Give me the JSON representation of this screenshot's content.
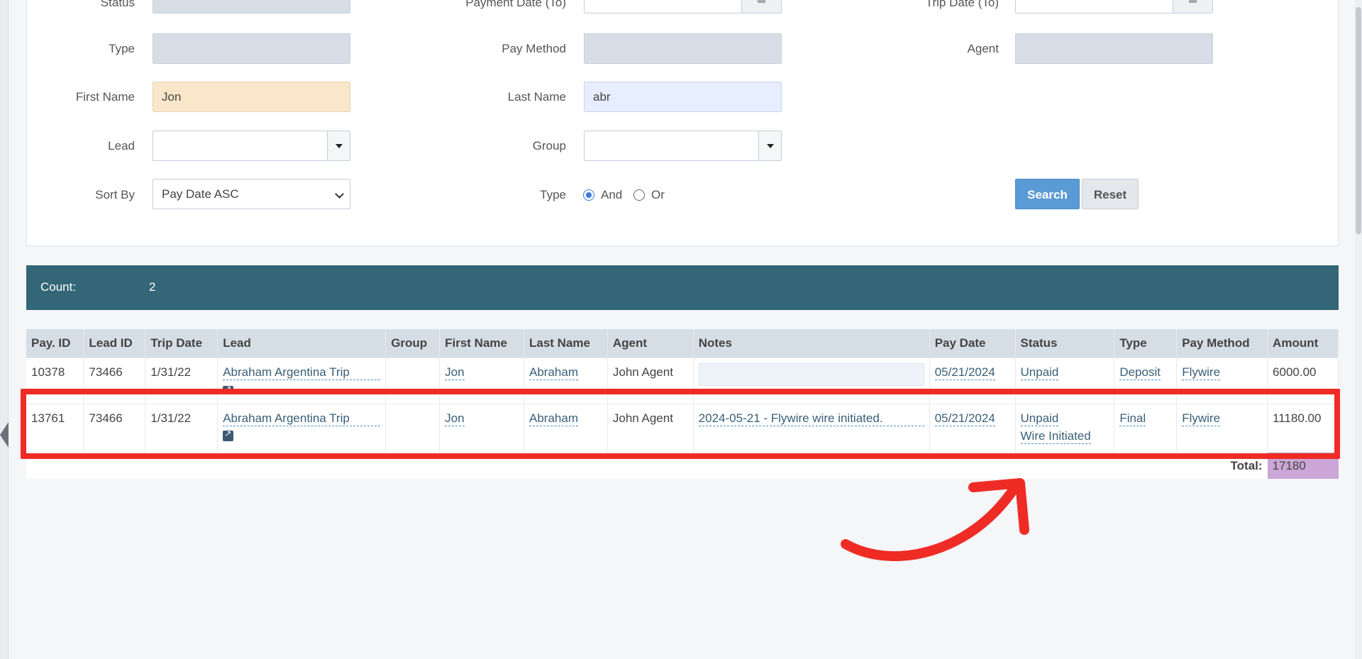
{
  "filters": {
    "row0": {
      "status_label": "Status",
      "pay_date_to_label": "Payment Date (To)",
      "trip_date_to_label": "Trip Date (To)"
    },
    "type_label": "Type",
    "pay_method_label": "Pay Method",
    "agent_label": "Agent",
    "first_name_label": "First Name",
    "first_name_value": "Jon",
    "last_name_label": "Last Name",
    "last_name_value": "abr",
    "lead_label": "Lead",
    "group_label": "Group",
    "sort_by_label": "Sort By",
    "sort_by_value": "Pay Date ASC",
    "match_type_label": "Type",
    "radio_and": "And",
    "radio_or": "Or",
    "search_button": "Search",
    "reset_button": "Reset",
    "calendar_icon": "calendar-icon"
  },
  "summary": {
    "count_label": "Count:",
    "count_value": "2"
  },
  "table": {
    "headers": [
      "Pay. ID",
      "Lead ID",
      "Trip Date",
      "Lead",
      "Group",
      "First Name",
      "Last Name",
      "Agent",
      "Notes",
      "Pay Date",
      "Status",
      "Type",
      "Pay Method",
      "Amount"
    ],
    "rows": [
      {
        "pay_id": "10378",
        "lead_id": "73466",
        "trip_date": "1/31/22",
        "lead": "Abraham Argentina Trip",
        "group": "",
        "first_name": "Jon",
        "last_name": "Abraham",
        "agent": "John Agent",
        "notes": "",
        "pay_date": "05/21/2024",
        "status": "Unpaid",
        "status2": "",
        "type": "Deposit",
        "pay_method": "Flywire",
        "amount": "6000.00"
      },
      {
        "pay_id": "13761",
        "lead_id": "73466",
        "trip_date": "1/31/22",
        "lead": "Abraham Argentina Trip",
        "group": "",
        "first_name": "Jon",
        "last_name": "Abraham",
        "agent": "John Agent",
        "notes": "2024-05-21 - Flywire wire initiated.",
        "pay_date": "05/21/2024",
        "status": "Unpaid",
        "status2": "Wire Initiated",
        "type": "Final",
        "pay_method": "Flywire",
        "amount": "11180.00"
      }
    ],
    "total_label": "Total:",
    "total_value": "17180"
  },
  "colors": {
    "highlight": "#ef2b25",
    "count_bar": "#336677",
    "total_cell": "#cba6d6",
    "search_button": "#5b9bd5"
  }
}
